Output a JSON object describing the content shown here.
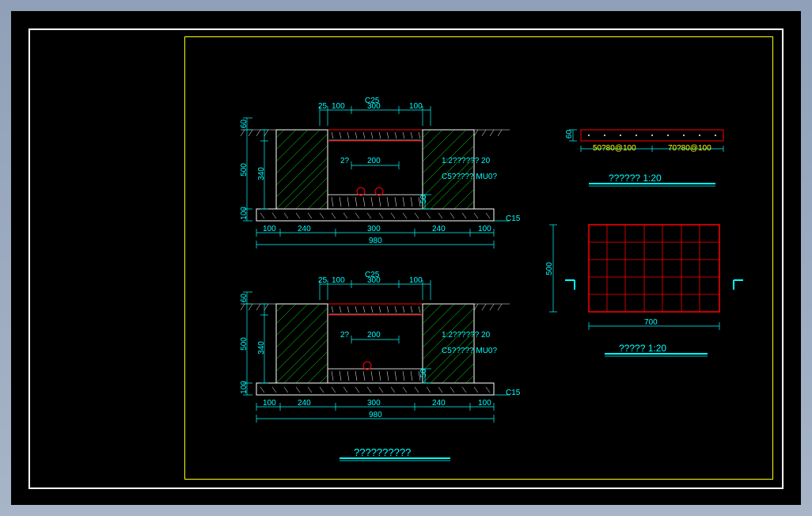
{
  "section1": {
    "top_label": "C25",
    "top_dim1": "25",
    "top_dim2": "100",
    "top_dim3": "300",
    "top_dim4": "100",
    "left_dim1": "60",
    "left_dim2": "500",
    "left_dim3": "100",
    "left_dim4": "340",
    "inner_dim1": "2?",
    "inner_dim2": "200",
    "inner_dim3": "50",
    "note1": "1:2?????? 20",
    "note2": "C5????? MU0?",
    "bottom_label": "C15",
    "bottom_dim1": "100",
    "bottom_dim2": "240",
    "bottom_dim3": "300",
    "bottom_dim4": "240",
    "bottom_dim5": "100",
    "bottom_total": "980"
  },
  "section2": {
    "top_label": "C25",
    "top_dim1": "25",
    "top_dim2": "100",
    "top_dim3": "300",
    "top_dim4": "100",
    "left_dim1": "60",
    "left_dim2": "500",
    "left_dim3": "100",
    "left_dim4": "340",
    "inner_dim1": "2?",
    "inner_dim2": "200",
    "inner_dim3": "50",
    "note1": "1:2?????? 20",
    "note2": "C5????? MU0?",
    "bottom_label": "C15",
    "bottom_dim1": "100",
    "bottom_dim2": "240",
    "bottom_dim3": "300",
    "bottom_dim4": "240",
    "bottom_dim5": "100",
    "bottom_total": "980"
  },
  "detail1": {
    "left_dim": "60",
    "bottom_dim1": "50?80@100",
    "bottom_dim2": "70?80@100",
    "title": "??????   1:20"
  },
  "detail2": {
    "left_dim": "500",
    "bottom_dim": "700",
    "title": "?????   1:20"
  },
  "main_title": "??????????"
}
